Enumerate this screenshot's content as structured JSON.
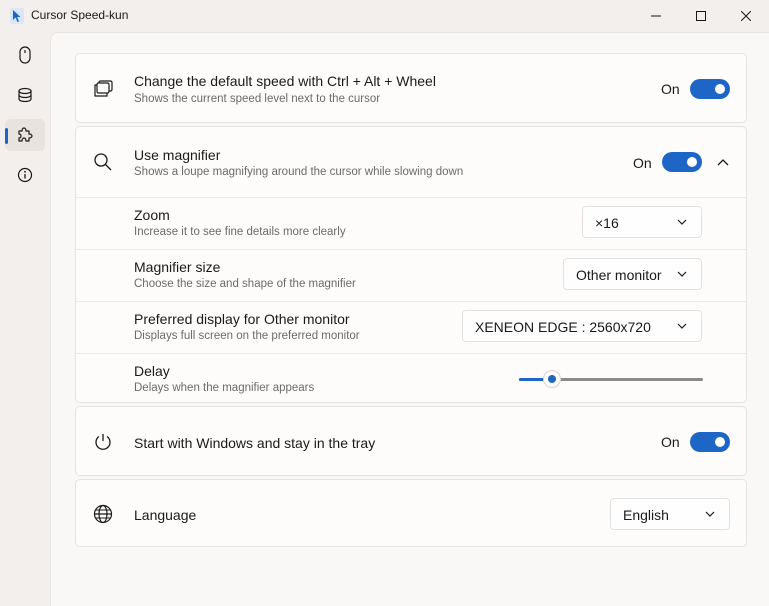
{
  "window": {
    "title": "Cursor Speed-kun",
    "accent_color": "#1e66c6"
  },
  "nav": {
    "items": [
      {
        "name": "mouse-icon",
        "active": false
      },
      {
        "name": "database-icon",
        "active": false
      },
      {
        "name": "puzzle-icon",
        "active": true
      },
      {
        "name": "info-icon",
        "active": false
      }
    ]
  },
  "settings": {
    "ctrl_alt_wheel": {
      "icon": "copy-windows-icon",
      "title": "Change the default speed with Ctrl + Alt + Wheel",
      "description": "Shows the current speed level next to the cursor",
      "toggle_label": "On",
      "toggle_on": true
    },
    "magnifier": {
      "icon": "search-icon",
      "title": "Use magnifier",
      "description": "Shows a loupe magnifying around the cursor while slowing down",
      "toggle_label": "On",
      "toggle_on": true,
      "expanded": true,
      "zoom": {
        "title": "Zoom",
        "description": "Increase it to see fine details more clearly",
        "value": "×16"
      },
      "size": {
        "title": "Magnifier size",
        "description": "Choose the size and shape of the magnifier",
        "value": "Other monitor"
      },
      "display": {
        "title": "Preferred display for Other monitor",
        "description": "Displays full screen on the preferred monitor",
        "value": "XENEON EDGE : 2560x720"
      },
      "delay": {
        "title": "Delay",
        "description": "Delays when the magnifier appears",
        "slider_fraction": 0.18
      }
    },
    "startup": {
      "icon": "power-icon",
      "title": "Start with Windows and stay in the tray",
      "toggle_label": "On",
      "toggle_on": true
    },
    "language": {
      "icon": "globe-icon",
      "title": "Language",
      "value": "English"
    }
  }
}
